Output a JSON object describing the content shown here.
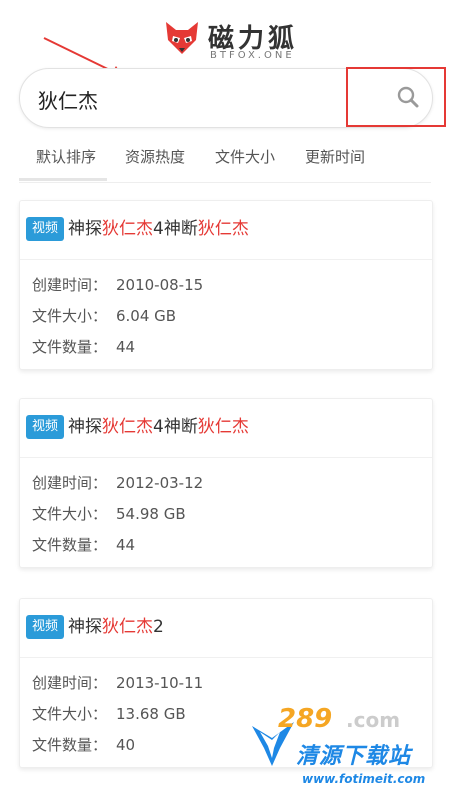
{
  "header": {
    "logo_text": "磁力狐",
    "logo_sub": "BTFOX.ONE",
    "brand_color": "#e53935"
  },
  "search": {
    "value": "狄仁杰",
    "placeholder": ""
  },
  "tabs": [
    {
      "label": "默认排序"
    },
    {
      "label": "资源热度"
    },
    {
      "label": "文件大小"
    },
    {
      "label": "更新时间"
    }
  ],
  "results": [
    {
      "badge": "视频",
      "title_parts": [
        "神探",
        "狄仁杰",
        "4神断",
        "狄仁杰"
      ],
      "created_label": "创建时间：",
      "created": "2010-08-15",
      "size_label": "文件大小：",
      "size": "6.04 GB",
      "count_label": "文件数量：",
      "count": "44"
    },
    {
      "badge": "视频",
      "title_parts": [
        "神探",
        "狄仁杰",
        "4神断",
        "狄仁杰"
      ],
      "created_label": "创建时间：",
      "created": "2012-03-12",
      "size_label": "文件大小：",
      "size": "54.98 GB",
      "count_label": "文件数量：",
      "count": "44"
    },
    {
      "badge": "视频",
      "title_parts": [
        "神探",
        "狄仁杰",
        "2",
        ""
      ],
      "created_label": "创建时间：",
      "created": "2013-10-11",
      "size_label": "文件大小：",
      "size": "13.68 GB",
      "count_label": "文件数量：",
      "count": "40"
    }
  ],
  "watermark": {
    "num": "289",
    "num2": ".com",
    "name": "清源下载站",
    "url": "www.fotimeit.com"
  },
  "colors": {
    "badge": "#2b9bd9",
    "highlight": "#e53935",
    "annotation": "#e53935"
  },
  "icons": {
    "search": "search-icon",
    "logo": "fox-logo-icon"
  }
}
